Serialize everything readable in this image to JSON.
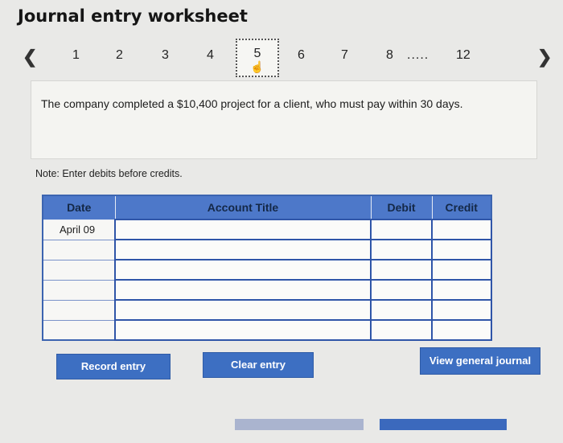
{
  "header": {
    "title": "Journal entry worksheet"
  },
  "pager": {
    "prev_icon": "chevron-left-icon",
    "next_icon": "chevron-right-icon",
    "pages": [
      "1",
      "2",
      "3",
      "4",
      "5",
      "6",
      "7",
      "8"
    ],
    "ellipsis": ".....",
    "last_page": "12",
    "active_page": "5",
    "cursor_icon": "hand-pointer-icon"
  },
  "question": {
    "text": "The company completed a $10,400 project for a client, who must pay within 30 days."
  },
  "note": "Note: Enter debits before credits.",
  "journal_table": {
    "headers": {
      "date": "Date",
      "account": "Account Title",
      "debit": "Debit",
      "credit": "Credit"
    },
    "rows": [
      {
        "date": "April 09",
        "account": "",
        "debit": "",
        "credit": ""
      },
      {
        "date": "",
        "account": "",
        "debit": "",
        "credit": ""
      },
      {
        "date": "",
        "account": "",
        "debit": "",
        "credit": ""
      },
      {
        "date": "",
        "account": "",
        "debit": "",
        "credit": ""
      },
      {
        "date": "",
        "account": "",
        "debit": "",
        "credit": ""
      },
      {
        "date": "",
        "account": "",
        "debit": "",
        "credit": ""
      }
    ]
  },
  "buttons": {
    "record": "Record entry",
    "clear": "Clear entry",
    "view": "View general journal"
  },
  "colors": {
    "header_blue": "#4d78c9",
    "button_blue": "#3d6fc2",
    "background": "#e9e9e7"
  }
}
